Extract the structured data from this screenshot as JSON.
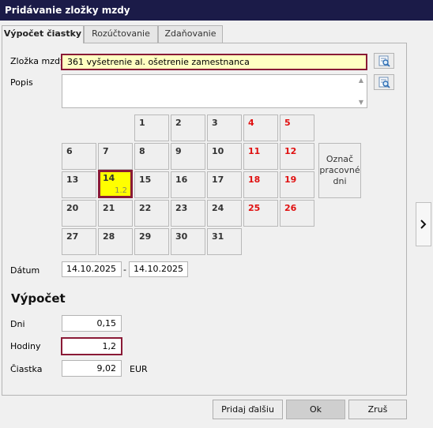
{
  "window": {
    "title": "Pridávanie zložky mzdy"
  },
  "tabs": [
    {
      "label": "Výpočet čiastky",
      "active": true
    },
    {
      "label": "Rozúčtovanie",
      "active": false
    },
    {
      "label": "Zdaňovanie",
      "active": false
    }
  ],
  "form": {
    "component_label": "Zložka mzdy",
    "component_value": "361  vyšetrenie al. ošetrenie zamestnanca",
    "description_label": "Popis",
    "description_value": ""
  },
  "calendar": {
    "days": [
      {
        "day": "1",
        "weekend": false
      },
      {
        "day": "2",
        "weekend": false
      },
      {
        "day": "3",
        "weekend": false
      },
      {
        "day": "4",
        "weekend": true
      },
      {
        "day": "5",
        "weekend": true
      },
      {
        "day": "6",
        "weekend": false
      },
      {
        "day": "7",
        "weekend": false
      },
      {
        "day": "8",
        "weekend": false
      },
      {
        "day": "9",
        "weekend": false
      },
      {
        "day": "10",
        "weekend": false
      },
      {
        "day": "11",
        "weekend": true
      },
      {
        "day": "12",
        "weekend": true
      },
      {
        "day": "13",
        "weekend": false
      },
      {
        "day": "14",
        "weekend": false,
        "selected": true,
        "hours": "1.2"
      },
      {
        "day": "15",
        "weekend": false
      },
      {
        "day": "16",
        "weekend": false
      },
      {
        "day": "17",
        "weekend": false
      },
      {
        "day": "18",
        "weekend": true
      },
      {
        "day": "19",
        "weekend": true
      },
      {
        "day": "20",
        "weekend": false
      },
      {
        "day": "21",
        "weekend": false
      },
      {
        "day": "22",
        "weekend": false
      },
      {
        "day": "23",
        "weekend": false
      },
      {
        "day": "24",
        "weekend": false
      },
      {
        "day": "25",
        "weekend": true
      },
      {
        "day": "26",
        "weekend": true
      },
      {
        "day": "27",
        "weekend": false
      },
      {
        "day": "28",
        "weekend": false
      },
      {
        "day": "29",
        "weekend": false
      },
      {
        "day": "30",
        "weekend": false
      },
      {
        "day": "31",
        "weekend": false
      }
    ],
    "mark_button_label": "Označ pracovné dni"
  },
  "date": {
    "label": "Dátum",
    "from": "14.10.2025",
    "separator": "-",
    "to": "14.10.2025"
  },
  "calc": {
    "title": "Výpočet",
    "days_label": "Dni",
    "days_value": "0,15",
    "hours_label": "Hodiny",
    "hours_value": "1,2",
    "amount_label": "Čiastka",
    "amount_value": "9,02",
    "currency": "EUR"
  },
  "buttons": {
    "add_next": "Pridaj ďalšiu",
    "ok": "Ok",
    "cancel": "Zruš"
  },
  "icons": {
    "lookup": "search-list-icon",
    "side": "chevron-right-icon",
    "scroll_up": "scroll-up-arrow-icon",
    "scroll_down": "scroll-down-arrow-icon"
  },
  "colors": {
    "titlebar": "#1b1b48",
    "highlight_field": "#ffffc2",
    "focus_border": "#8a1a36",
    "weekend_text": "#e01010",
    "selected_day": "#ffff00"
  }
}
